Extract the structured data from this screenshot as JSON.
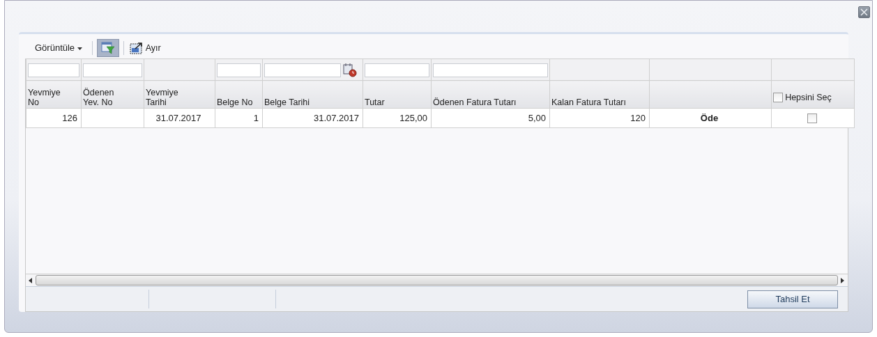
{
  "toolbar": {
    "view_menu": "Görüntüle",
    "filter_toggle": {
      "selected": true
    },
    "detach_button": "Ayır"
  },
  "columns": [
    {
      "label_lines": [
        "Yevmiye",
        "No"
      ],
      "kind": "text"
    },
    {
      "label_lines": [
        "Ödenen",
        "Yev. No"
      ],
      "kind": "text"
    },
    {
      "label_lines": [
        "Yevmiye",
        "Tarihi"
      ],
      "kind": "blank"
    },
    {
      "label_lines": [
        "Belge No"
      ],
      "kind": "text"
    },
    {
      "label_lines": [
        "Belge Tarihi"
      ],
      "kind": "date"
    },
    {
      "label_lines": [
        "Tutar"
      ],
      "kind": "text"
    },
    {
      "label_lines": [
        "Ödenen Fatura Tutarı"
      ],
      "kind": "text"
    },
    {
      "label_lines": [
        "Kalan Fatura Tutarı"
      ],
      "kind": "blank"
    },
    {
      "kind": "blank"
    },
    {
      "select_all": {
        "label": "Hepsini Seç",
        "checked": false
      },
      "kind": "blank"
    }
  ],
  "rows": [
    {
      "cells": [
        "126",
        "",
        "31.07.2017",
        "1",
        "31.07.2017",
        "125,00",
        "5,00",
        "120"
      ],
      "action": "Öde",
      "checked": false
    }
  ],
  "footer": {
    "button": "Tahsil Et"
  }
}
